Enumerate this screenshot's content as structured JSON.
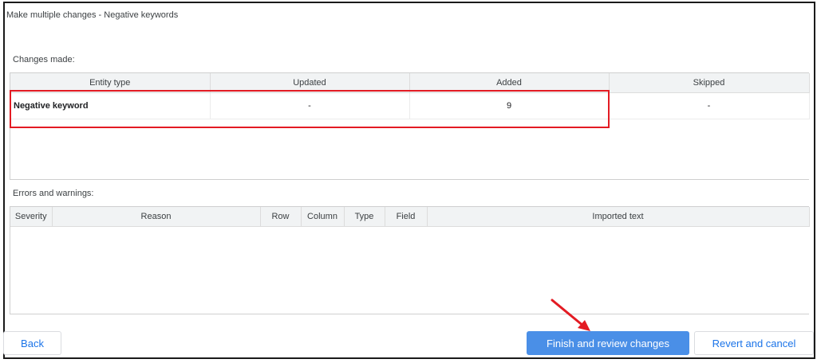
{
  "dialog": {
    "title": "Make multiple changes - Negative keywords"
  },
  "changes": {
    "label": "Changes made:",
    "headers": [
      "Entity type",
      "Updated",
      "Added",
      "Skipped"
    ],
    "rows": [
      {
        "entity_type": "Negative keyword",
        "updated": "-",
        "added": "9",
        "skipped": "-"
      }
    ]
  },
  "errors": {
    "label": "Errors and warnings:",
    "headers": [
      "Severity",
      "Reason",
      "Row",
      "Column",
      "Type",
      "Field",
      "Imported text"
    ]
  },
  "buttons": {
    "back": "Back",
    "finish": "Finish and review changes",
    "revert": "Revert and cancel"
  },
  "colors": {
    "annotation_red": "#e31b23",
    "primary_blue": "#4a8fe7"
  }
}
